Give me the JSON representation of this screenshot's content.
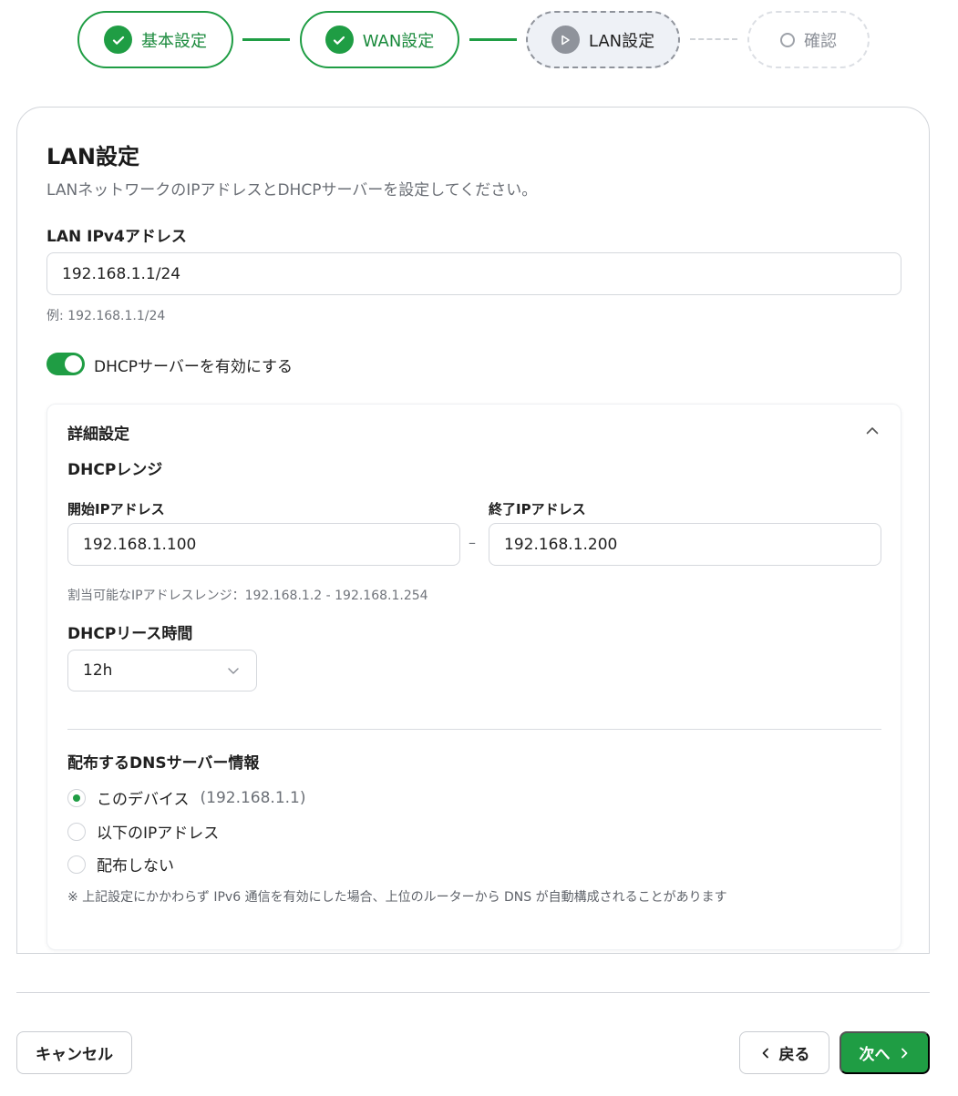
{
  "stepper": {
    "steps": [
      {
        "label": "基本設定",
        "state": "done",
        "icon": "check-icon"
      },
      {
        "label": "WAN設定",
        "state": "done",
        "icon": "check-icon"
      },
      {
        "label": "LAN設定",
        "state": "current",
        "icon": "play-icon"
      },
      {
        "label": "確認",
        "state": "todo",
        "icon": "circle-icon"
      }
    ]
  },
  "card": {
    "title": "LAN設定",
    "subtitle": "LANネットワークのIPアドレスとDHCPサーバーを設定してください。",
    "ipv4": {
      "label": "LAN IPv4アドレス",
      "value": "192.168.1.1/24",
      "hint": "例: 192.168.1.1/24"
    },
    "dhcp_toggle": {
      "label": "DHCPサーバーを有効にする",
      "enabled": true
    },
    "advanced": {
      "title": "詳細設定",
      "expanded": true,
      "range": {
        "title": "DHCPレンジ",
        "start_label": "開始IPアドレス",
        "start_value": "192.168.1.100",
        "separator": "–",
        "end_label": "終了IPアドレス",
        "end_value": "192.168.1.200",
        "hint": "割当可能なIPアドレスレンジ：192.168.1.2 - 192.168.1.254"
      },
      "lease": {
        "title": "DHCPリース時間",
        "value": "12h"
      },
      "dns": {
        "title": "配布するDNSサーバー情報",
        "options": [
          {
            "label": "このデバイス",
            "note": "(192.168.1.1)",
            "checked": true
          },
          {
            "label": "以下のIPアドレス",
            "note": "",
            "checked": false
          },
          {
            "label": "配布しない",
            "note": "",
            "checked": false
          }
        ],
        "footnote": "※ 上記設定にかかわらず IPv6 通信を有効にした場合、上位のルーターから DNS が自動構成されることがあります"
      }
    }
  },
  "footer": {
    "cancel_label": "キャンセル",
    "back_label": "戻る",
    "next_label": "次へ"
  },
  "colors": {
    "accent": "#1f9d44",
    "current_step": "#8f939b",
    "border": "#d5d8dd"
  }
}
